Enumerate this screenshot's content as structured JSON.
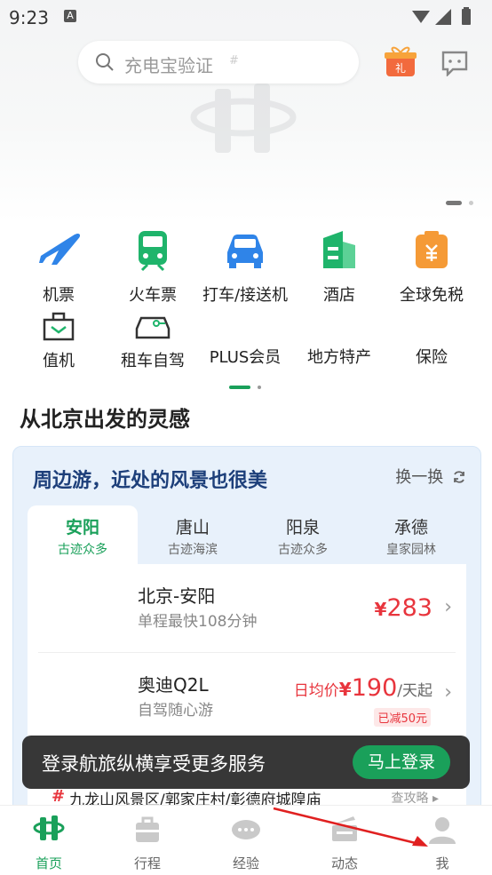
{
  "status_bar": {
    "time": "9:23",
    "notif_icon": "A"
  },
  "search": {
    "placeholder": "充电宝验证",
    "hash": "#"
  },
  "header_icons": {
    "gift": "gift-icon",
    "message": "message-icon",
    "gift_text": "礼"
  },
  "services_row1": [
    {
      "label": "机票",
      "icon": "plane-icon"
    },
    {
      "label": "火车票",
      "icon": "train-icon"
    },
    {
      "label": "打车/接送机",
      "icon": "car-icon"
    },
    {
      "label": "酒店",
      "icon": "hotel-icon"
    },
    {
      "label": "全球免税",
      "icon": "duty-free-icon"
    }
  ],
  "services_row2": [
    {
      "label": "值机",
      "icon": "checkin-icon"
    },
    {
      "label": "租车自驾",
      "icon": "rental-car-icon"
    },
    {
      "label": "PLUS会员",
      "icon": ""
    },
    {
      "label": "地方特产",
      "icon": ""
    },
    {
      "label": "保险",
      "icon": ""
    }
  ],
  "inspiration": {
    "title": "从北京出发的灵感",
    "card_title": "周边游，近处的风景也很美",
    "refresh_label": "换一换",
    "tabs": [
      {
        "name": "安阳",
        "sub": "古迹众多",
        "active": true
      },
      {
        "name": "唐山",
        "sub": "古迹海滨"
      },
      {
        "name": "阳泉",
        "sub": "古迹众多"
      },
      {
        "name": "承德",
        "sub": "皇家园林"
      }
    ],
    "rows": [
      {
        "title": "北京-安阳",
        "subtitle": "单程最快108分钟",
        "currency": "¥",
        "price": "283"
      },
      {
        "title": "奥迪Q2L",
        "subtitle": "自驾随心游",
        "prefix": "日均价",
        "currency": "¥",
        "price": "190",
        "suffix": "/天起",
        "badge": "已减50元"
      }
    ]
  },
  "toast": {
    "text": "登录航旅纵横享受更多服务",
    "button": "马上登录"
  },
  "peek": {
    "hash": "#",
    "text": "九龙山风景区/郭家庄村/彰德府城隍庙",
    "right": "查攻略 ▸"
  },
  "nav": [
    {
      "label": "首页",
      "active": true
    },
    {
      "label": "行程"
    },
    {
      "label": "经验"
    },
    {
      "label": "动态"
    },
    {
      "label": "我"
    }
  ],
  "colors": {
    "brand_green": "#1aa05a",
    "price_red": "#e8353d",
    "card_title_blue": "#1d3f7a"
  }
}
